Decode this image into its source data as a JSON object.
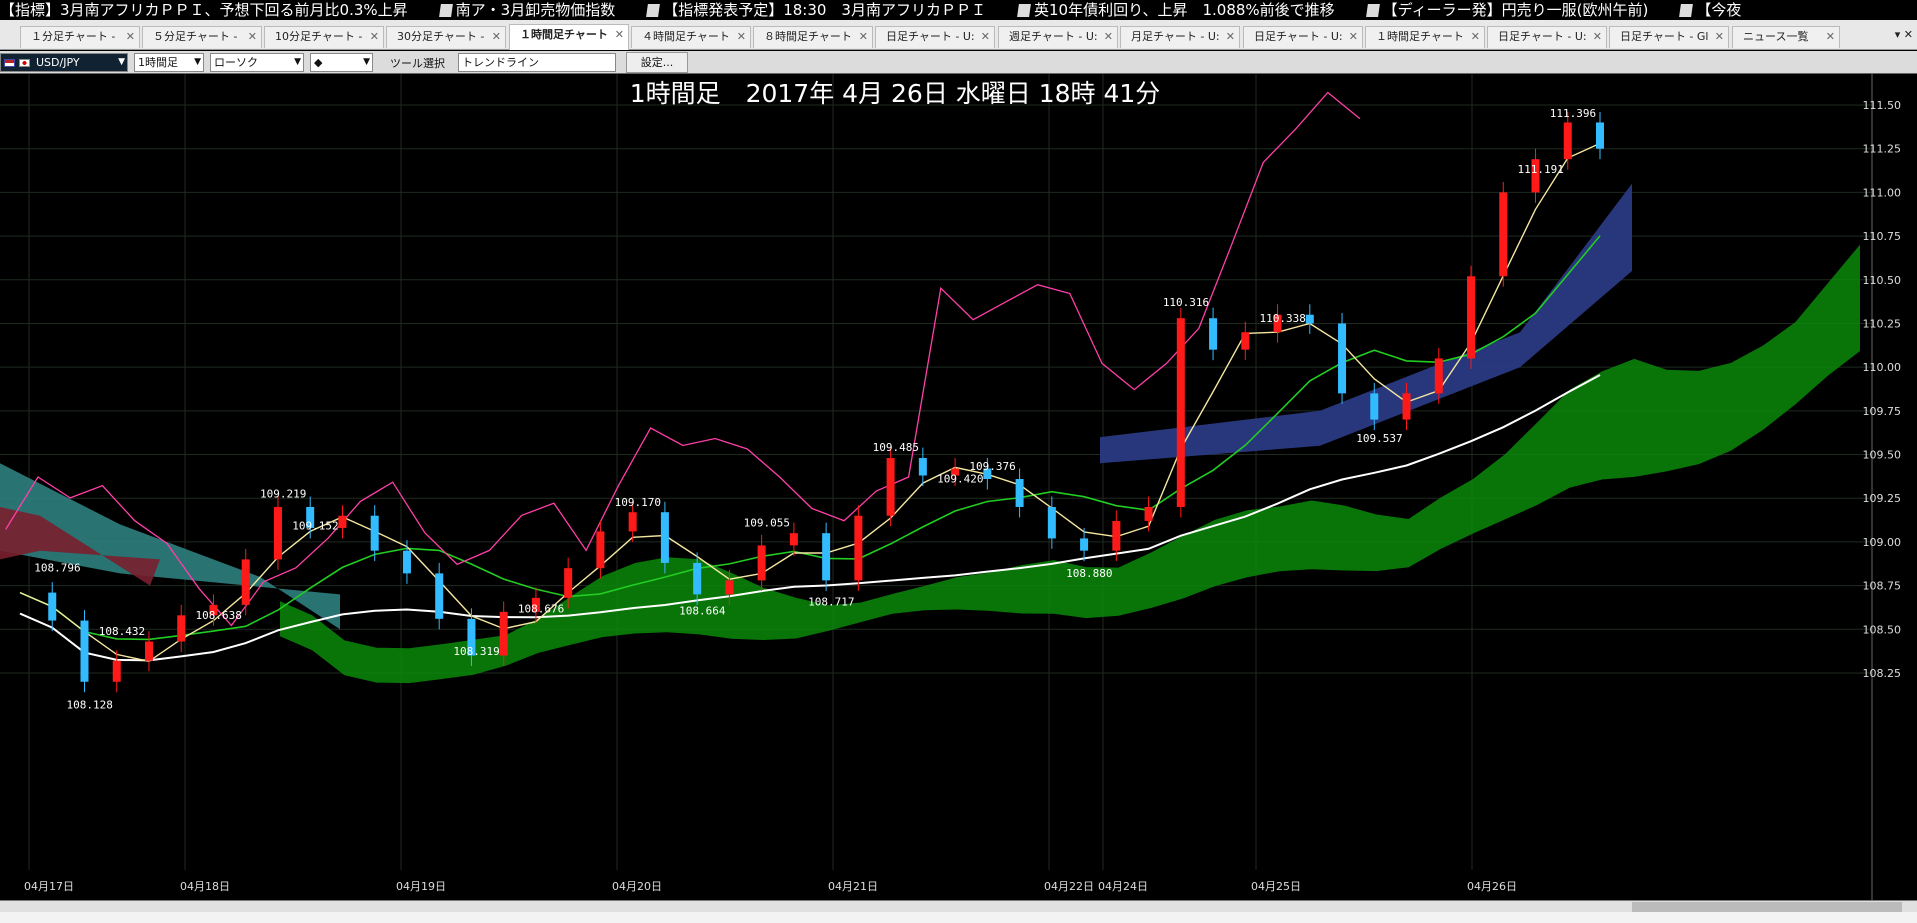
{
  "ticker": {
    "items": [
      "【指標】3月南アフリカＰＰＩ、予想下回る前月比0.3%上昇",
      "南ア・3月卸売物価指数",
      "【指標発表予定】18:30　3月南アフリカＰＰＩ",
      "英10年債利回り、上昇　1.088%前後で推移",
      "【ディーラー発】円売り一服(欧州午前)",
      "【今夜"
    ]
  },
  "tabs": [
    {
      "label": "１分足チャート - ",
      "active": false
    },
    {
      "label": "５分足チャート - ",
      "active": false
    },
    {
      "label": "10分足チャート - ",
      "active": false
    },
    {
      "label": "30分足チャート - ",
      "active": false
    },
    {
      "label": "１時間足チャート",
      "active": true
    },
    {
      "label": "４時間足チャート",
      "active": false
    },
    {
      "label": "８時間足チャート",
      "active": false
    },
    {
      "label": "日足チャート - U:",
      "active": false
    },
    {
      "label": "週足チャート - U:",
      "active": false
    },
    {
      "label": "月足チャート - U:",
      "active": false
    },
    {
      "label": "日足チャート - U:",
      "active": false
    },
    {
      "label": "１時間足チャート",
      "active": false
    },
    {
      "label": "日足チャート - U:",
      "active": false
    },
    {
      "label": "日足チャート - Gl",
      "active": false
    },
    {
      "label": "ニュース一覧",
      "active": false
    }
  ],
  "tab_controls": "▾ ✕",
  "toolbar": {
    "symbol": "USD/JPY",
    "timeframe": "1時間足",
    "chart_type": "ローソク",
    "marker": "◆",
    "tool_label": "ツール選択",
    "tool_value": "トレンドライン",
    "settings_button": "設定..."
  },
  "colors": {
    "up": "#ff1a1a",
    "down": "#33bbff",
    "ma_short": "#f5e6a0",
    "ma_mid": "#22cc22",
    "ma_long": "#ffffff",
    "chikou": "#ff3fa8",
    "kumo_bull": "#0a8a0a",
    "kumo_bear": "#7a1f2e",
    "kumo_teal": "#2e8080",
    "kumo_navy": "#2a3a82"
  },
  "chart_data": {
    "type": "line",
    "title": "1時間足　2017年 4月 26日 水曜日 18時 41分",
    "ylim": [
      108.05,
      111.6
    ],
    "y_ticks": [
      "111.50",
      "111.25",
      "111.00",
      "110.75",
      "110.50",
      "110.25",
      "110.00",
      "109.75",
      "109.50",
      "109.25",
      "109.00",
      "108.75",
      "108.50",
      "108.25"
    ],
    "x_ticks": [
      "04月17日",
      "04月18日",
      "04月19日",
      "04月20日",
      "04月21日",
      "04月22日",
      "04月24日",
      "04月25日",
      "04月26日"
    ],
    "annotations": [
      "108.796",
      "108.128",
      "108.432",
      "108.638",
      "109.219",
      "109.152",
      "108.319",
      "108.676",
      "109.170",
      "108.664",
      "109.055",
      "108.717",
      "109.485",
      "109.420",
      "109.376",
      "108.880",
      "110.316",
      "110.338",
      "109.537",
      "111.191",
      "111.396"
    ],
    "grid": true,
    "series": [
      {
        "name": "price",
        "values": [
          108.71,
          108.55,
          108.2,
          108.32,
          108.43,
          108.58,
          108.64,
          108.9,
          109.2,
          109.08,
          109.15,
          108.95,
          108.82,
          108.56,
          108.35,
          108.6,
          108.68,
          108.85,
          109.06,
          109.17,
          108.88,
          108.7,
          108.78,
          108.98,
          109.05,
          108.78,
          109.15,
          109.48,
          109.38,
          109.42,
          109.36,
          109.2,
          109.02,
          108.95,
          109.12,
          109.2,
          110.28,
          110.1,
          110.2,
          110.3,
          110.25,
          109.85,
          109.7,
          109.85,
          110.05,
          110.52,
          111.0,
          111.19,
          111.4,
          111.25
        ]
      }
    ]
  }
}
